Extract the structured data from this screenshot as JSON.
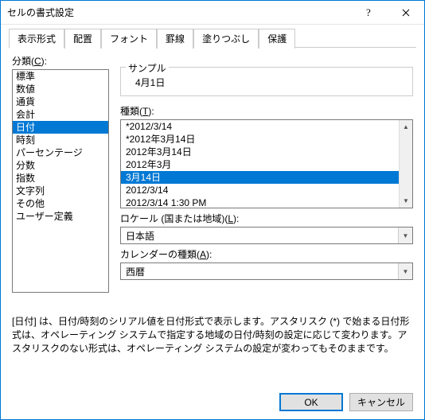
{
  "title": "セルの書式設定",
  "tabs": [
    "表示形式",
    "配置",
    "フォント",
    "罫線",
    "塗りつぶし",
    "保護"
  ],
  "category_label_pre": "分類(",
  "category_label_accel": "C",
  "category_label_post": "):",
  "categories": [
    "標準",
    "数値",
    "通貨",
    "会計",
    "日付",
    "時刻",
    "パーセンテージ",
    "分数",
    "指数",
    "文字列",
    "その他",
    "ユーザー定義"
  ],
  "selected_category_index": 4,
  "sample_legend": "サンプル",
  "sample_value": "4月1日",
  "type_label_pre": "種類(",
  "type_label_accel": "T",
  "type_label_post": "):",
  "types": [
    "*2012/3/14",
    "*2012年3月14日",
    "2012年3月14日",
    "2012年3月",
    "3月14日",
    "2012/3/14",
    "2012/3/14 1:30 PM"
  ],
  "selected_type_index": 4,
  "locale_label_pre": "ロケール (国または地域)(",
  "locale_label_accel": "L",
  "locale_label_post": "):",
  "locale_value": "日本語",
  "calendar_label_pre": "カレンダーの種類(",
  "calendar_label_accel": "A",
  "calendar_label_post": "):",
  "calendar_value": "西暦",
  "description": "[日付] は、日付/時刻のシリアル値を日付形式で表示します。アスタリスク (*) で始まる日付形式は、オペレーティング システムで指定する地域の日付/時刻の設定に応じて変わります。アスタリスクのない形式は、オペレーティング システムの設定が変わってもそのままです。",
  "ok_label": "OK",
  "cancel_label": "キャンセル"
}
